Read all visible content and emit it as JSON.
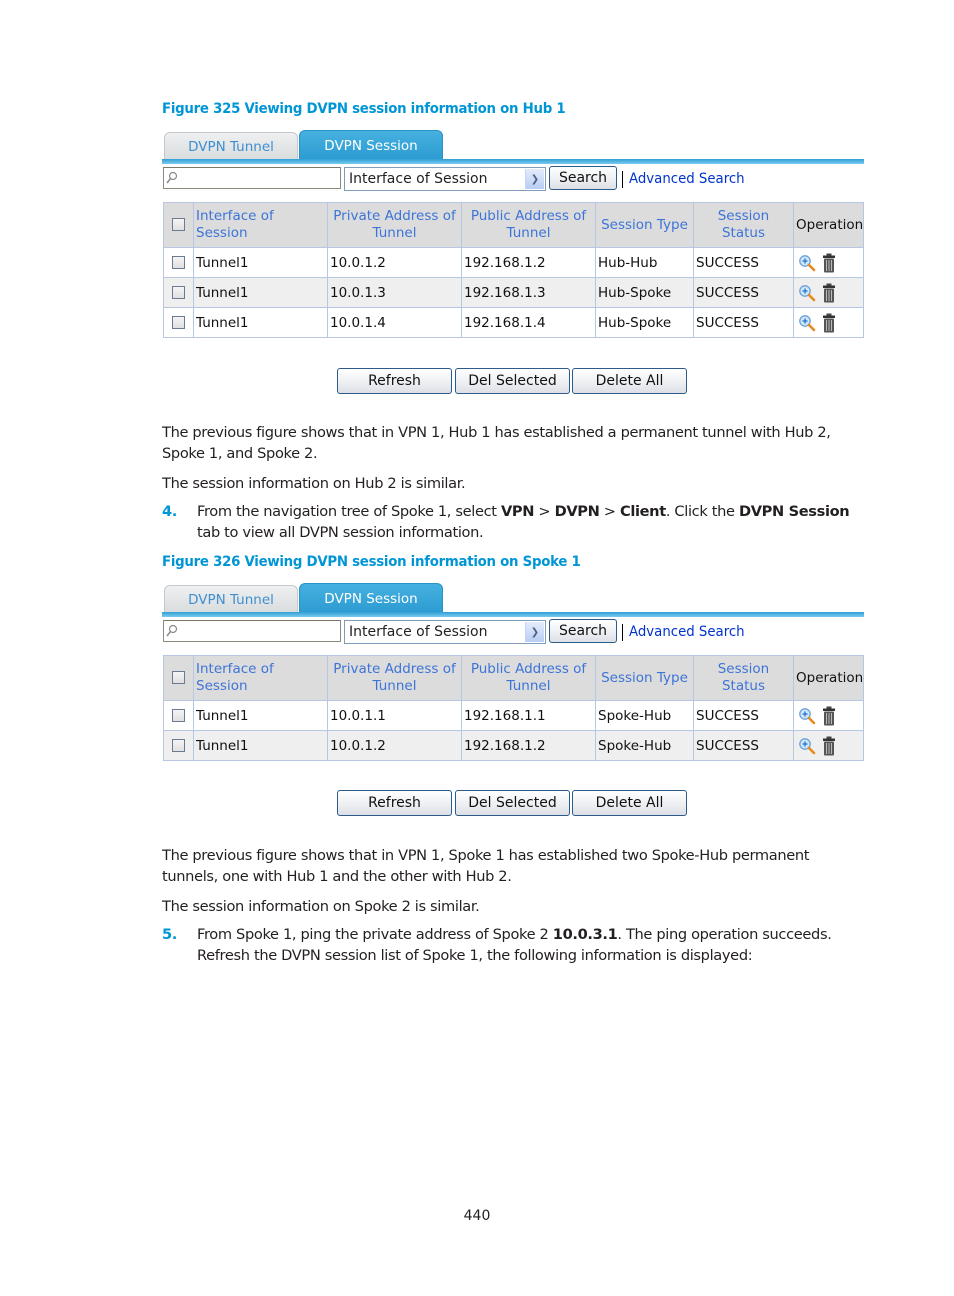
{
  "figures": [
    {
      "caption": "Figure 325 Viewing DVPN session information on Hub 1",
      "tabs": [
        {
          "label": "DVPN Tunnel",
          "active": false
        },
        {
          "label": "DVPN Session",
          "active": true
        }
      ],
      "search": {
        "value": "",
        "icon": "magnifier-icon",
        "filter_selected": "Interface of Session",
        "search_label": "Search",
        "advanced_label": "Advanced Search"
      },
      "columns": [
        "Interface of Session",
        "Private Address of Tunnel",
        "Public Address of Tunnel",
        "Session Type",
        "Session Status",
        "Operation"
      ],
      "rows": [
        {
          "interface": "Tunnel1",
          "private": "10.0.1.2",
          "public": "192.168.1.2",
          "type": "Hub-Hub",
          "status": "SUCCESS"
        },
        {
          "interface": "Tunnel1",
          "private": "10.0.1.3",
          "public": "192.168.1.3",
          "type": "Hub-Spoke",
          "status": "SUCCESS"
        },
        {
          "interface": "Tunnel1",
          "private": "10.0.1.4",
          "public": "192.168.1.4",
          "type": "Hub-Spoke",
          "status": "SUCCESS"
        }
      ],
      "operations": [
        "zoom-in-icon",
        "trash-icon"
      ],
      "buttons": {
        "refresh": "Refresh",
        "del_selected": "Del Selected",
        "delete_all": "Delete All"
      }
    },
    {
      "caption": "Figure 326 Viewing DVPN session information on Spoke 1",
      "tabs": [
        {
          "label": "DVPN Tunnel",
          "active": false
        },
        {
          "label": "DVPN Session",
          "active": true
        }
      ],
      "search": {
        "value": "",
        "icon": "magnifier-icon",
        "filter_selected": "Interface of Session",
        "search_label": "Search",
        "advanced_label": "Advanced Search"
      },
      "columns": [
        "Interface of Session",
        "Private Address of Tunnel",
        "Public Address of Tunnel",
        "Session Type",
        "Session Status",
        "Operation"
      ],
      "rows": [
        {
          "interface": "Tunnel1",
          "private": "10.0.1.1",
          "public": "192.168.1.1",
          "type": "Spoke-Hub",
          "status": "SUCCESS"
        },
        {
          "interface": "Tunnel1",
          "private": "10.0.1.2",
          "public": "192.168.1.2",
          "type": "Spoke-Hub",
          "status": "SUCCESS"
        }
      ],
      "operations": [
        "zoom-in-icon",
        "trash-icon"
      ],
      "buttons": {
        "refresh": "Refresh",
        "del_selected": "Del Selected",
        "delete_all": "Delete All"
      }
    }
  ],
  "text": {
    "p1": "The previous figure shows that in VPN 1, Hub 1 has established a permanent tunnel with Hub 2, Spoke 1, and Spoke 2.",
    "p2": "The session information on Hub 2 is similar.",
    "step4": {
      "num": "4.",
      "parts": [
        "From the navigation tree of Spoke 1, select ",
        "VPN",
        " > ",
        "DVPN",
        " > ",
        "Client",
        ". Click the ",
        "DVPN Session",
        " tab to view all DVPN session information."
      ]
    },
    "p3": "The previous figure shows that in VPN 1, Spoke 1 has established two Spoke-Hub permanent tunnels, one with Hub 1 and the other with Hub 2.",
    "p4": "The session information on Spoke 2 is similar.",
    "step5": {
      "num": "5.",
      "parts": [
        "From Spoke 1, ping the private address of Spoke 2 ",
        "10.0.3.1",
        ". The ping operation succeeds. Refresh the DVPN session list of Spoke 1, the following information is displayed:"
      ]
    }
  },
  "page_number": "440",
  "colors": {
    "caption": "#0096d6",
    "tab_active": "#2c9bd1",
    "header_text": "#3d74d8",
    "link": "#0033cc"
  }
}
